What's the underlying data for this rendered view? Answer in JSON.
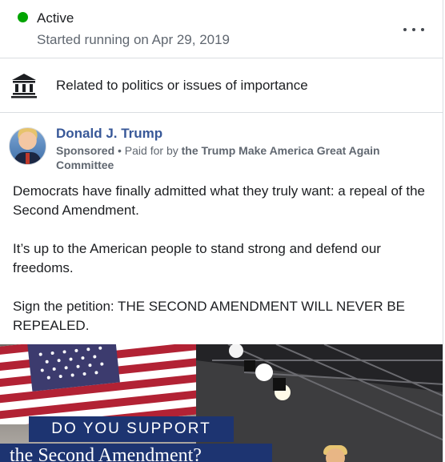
{
  "status": {
    "label": "Active",
    "started": "Started running on Apr 29, 2019",
    "color": "#00a400"
  },
  "category": {
    "label": "Related to politics or issues of importance",
    "icon": "government-building-icon"
  },
  "post": {
    "page_name": "Donald J. Trump",
    "sponsored": "Sponsored",
    "paid_prefix": " • Paid for by ",
    "paid_by": "the Trump Make America Great Again Committee",
    "paragraphs": [
      "Democrats have finally admitted what they truly want: a repeal of the Second Amendment.",
      "It’s up to the American people to stand strong and defend our freedoms.",
      "Sign the petition: THE SECOND AMENDMENT WILL NEVER BE REPEALED."
    ],
    "image": {
      "headline": "DO YOU SUPPORT",
      "subheadline": "the Second Amendment?"
    }
  },
  "colors": {
    "link": "#385898",
    "muted": "#606770",
    "divider": "#dadde1",
    "banner": "#1d3471"
  }
}
